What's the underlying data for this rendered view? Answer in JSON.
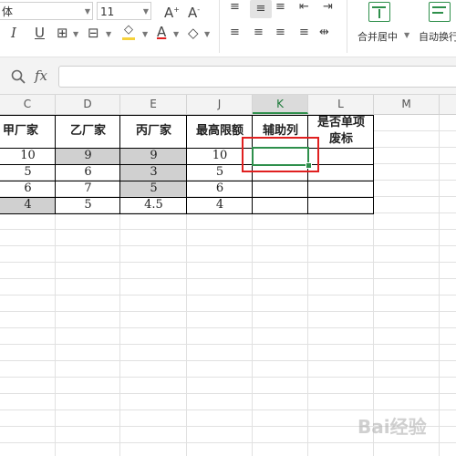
{
  "ribbon": {
    "font_name": "体",
    "font_size": "11",
    "merge_label": "合并居中",
    "wrap_label": "自动换行"
  },
  "formula_bar": {
    "fx_label": "fx",
    "content": ""
  },
  "columns": [
    "C",
    "D",
    "E",
    "J",
    "K",
    "L",
    "M"
  ],
  "active_column": "K",
  "table": {
    "headers": [
      "甲厂家",
      "乙厂家",
      "丙厂家",
      "最高限额",
      "辅助列",
      "是否单项",
      "废标"
    ],
    "rows": [
      [
        "10",
        "9",
        "9",
        "10",
        "",
        ""
      ],
      [
        "5",
        "6",
        "3",
        "5",
        "",
        ""
      ],
      [
        "6",
        "7",
        "5",
        "6",
        "",
        ""
      ],
      [
        "4",
        "5",
        "4.5",
        "4",
        "",
        ""
      ]
    ]
  },
  "watermark": "Bai经验",
  "colors": {
    "highlight_gray": "#d0d0d0",
    "selection_green": "#2e8f4b",
    "annotation_red": "#e02020"
  }
}
